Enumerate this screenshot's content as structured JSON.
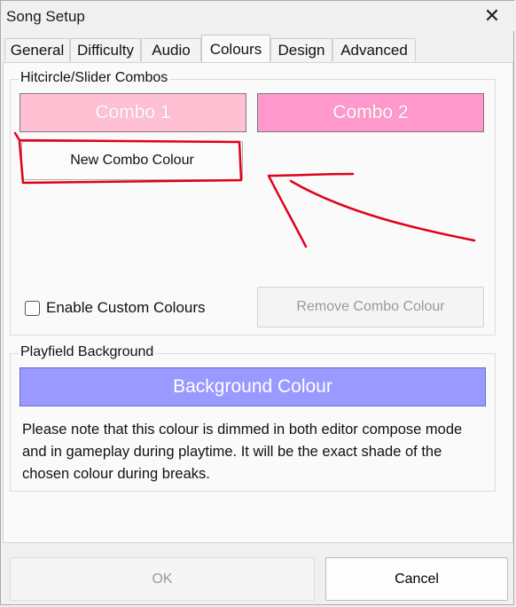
{
  "window": {
    "title": "Song Setup",
    "close_glyph": "✕"
  },
  "tabs": [
    {
      "label": "General"
    },
    {
      "label": "Difficulty"
    },
    {
      "label": "Audio"
    },
    {
      "label": "Colours",
      "active": true
    },
    {
      "label": "Design"
    },
    {
      "label": "Advanced"
    }
  ],
  "combos_group": {
    "label": "Hitcircle/Slider Combos",
    "combo1": {
      "label": "Combo 1",
      "color": "#ffc0d4"
    },
    "combo2": {
      "label": "Combo 2",
      "color": "#ff99cc"
    },
    "new_button": "New Combo Colour",
    "enable_custom": {
      "label": "Enable Custom Colours",
      "checked": false
    },
    "remove_button": "Remove Combo Colour"
  },
  "playfield_group": {
    "label": "Playfield Background",
    "background_button": {
      "label": "Background Colour",
      "color": "#9999ff"
    },
    "note": "Please note that this colour is dimmed in both editor compose mode and in gameplay during playtime.  It will be the exact shade of the chosen colour during breaks."
  },
  "footer": {
    "ok": "OK",
    "cancel": "Cancel"
  },
  "annotation": {
    "color": "#e0001a",
    "icons": [
      "highlight-box-annotation",
      "arrow-annotation"
    ]
  }
}
